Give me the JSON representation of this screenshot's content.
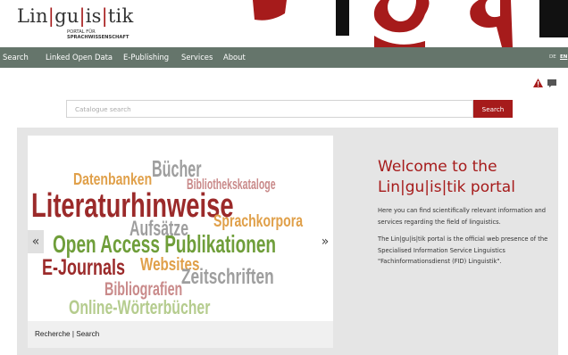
{
  "logo": {
    "parts": [
      "Lin",
      "gu",
      "is",
      "tik"
    ],
    "subtitle_line1": "PORTAL FÜR",
    "subtitle_line2": "SPRACHWISSENSCHAFT"
  },
  "nav": {
    "items": [
      "Search",
      "Linked Open Data",
      "E-Publishing",
      "Services",
      "About"
    ],
    "languages": [
      "DE",
      "EN"
    ],
    "active_language": "EN"
  },
  "toolbar": {
    "icons": [
      "alert-icon",
      "comment-icon"
    ],
    "alert_color": "#a61b1b"
  },
  "search": {
    "placeholder": "Catalogue search",
    "button_label": "Search"
  },
  "carousel": {
    "words": [
      {
        "text": "Bücher",
        "color": "#9e9e9e"
      },
      {
        "text": "Datenbanken",
        "color": "#e0a04a"
      },
      {
        "text": "Bibliothekskataloge",
        "color": "#c98a8a"
      },
      {
        "text": "Literaturhinweise",
        "color": "#9b2a2a"
      },
      {
        "text": "Aufsätze",
        "color": "#9e9e9e"
      },
      {
        "text": "Sprachkorpora",
        "color": "#e0a04a"
      },
      {
        "text": "Open Access Publikationen",
        "color": "#6f9e3a"
      },
      {
        "text": "E-Journals",
        "color": "#9b2a2a"
      },
      {
        "text": "Websites",
        "color": "#e0a04a"
      },
      {
        "text": "Zeitschriften",
        "color": "#9e9e9e"
      },
      {
        "text": "Bibliografien",
        "color": "#c98a8a"
      },
      {
        "text": "Online-Wörterbücher",
        "color": "#b5cc8e"
      }
    ],
    "prev_label": "«",
    "next_label": "»",
    "caption": "Recherche | Search"
  },
  "welcome": {
    "title": "Welcome to the Lin|gu|is|tik portal",
    "paragraph1": "Here you can find scientifically relevant information and services regarding the field of linguistics.",
    "paragraph2": "The Lin|gu|is|tik portal is the official web presence of the Specialised Information Service Linguistics \"Fachinformationsdienst (FID) Linguistik\"."
  },
  "colors": {
    "brand_red": "#a61b1b",
    "nav_green": "#65756b",
    "panel_grey": "#e5e5e5"
  }
}
